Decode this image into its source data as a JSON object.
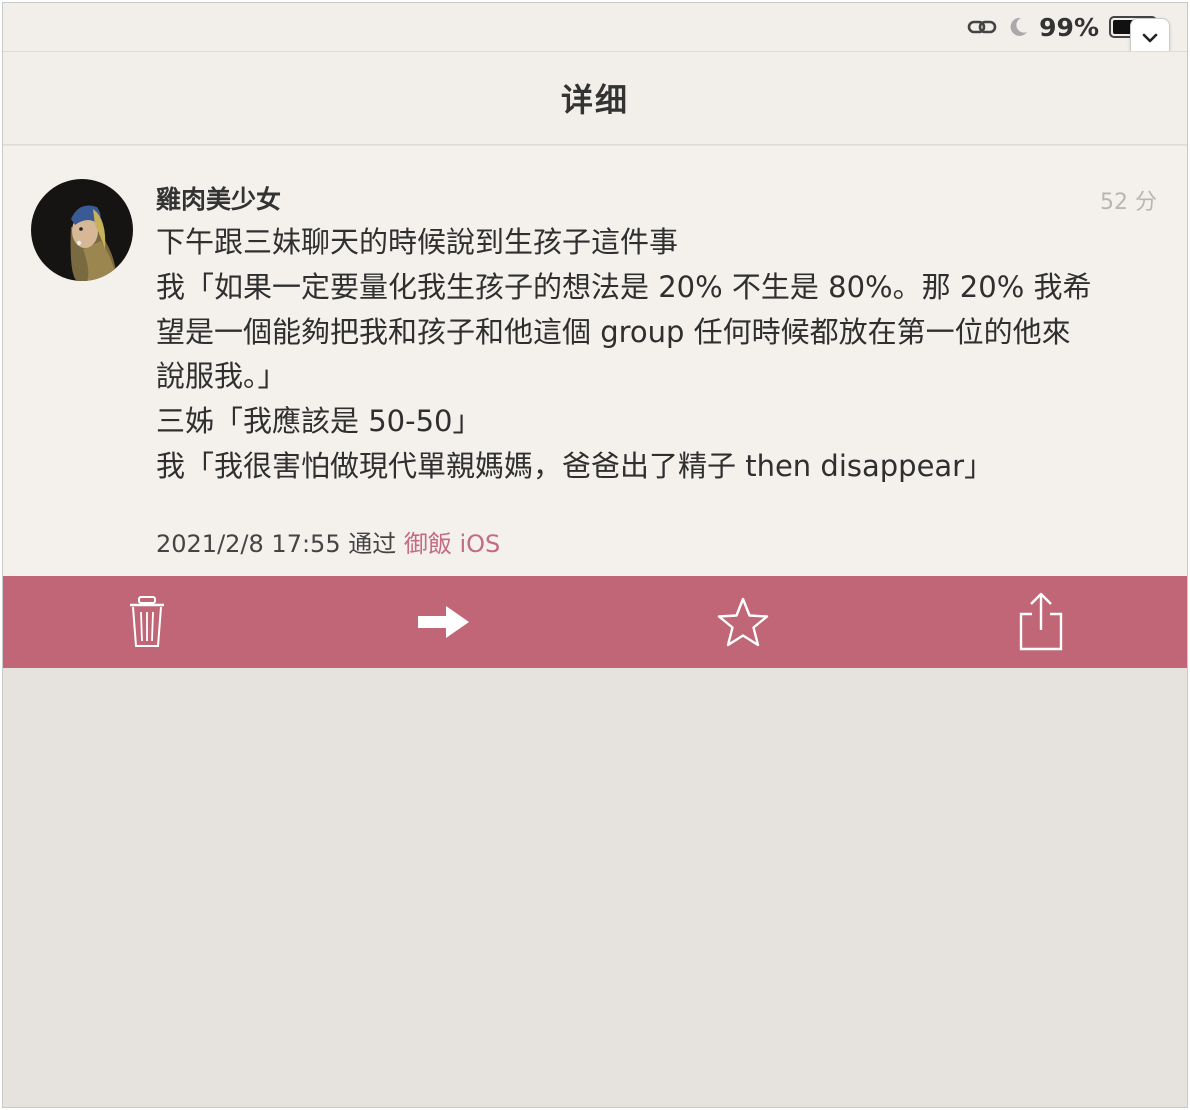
{
  "status_bar": {
    "battery_percent": "99%",
    "battery_level": 0.99,
    "icons": [
      "link-icon",
      "moon-icon",
      "battery-icon"
    ]
  },
  "navbar": {
    "title": "详细"
  },
  "post": {
    "username": "雞肉美少女",
    "time_ago": "52 分",
    "lines": [
      "下午跟三妹聊天的時候說到生孩子這件事",
      "我「如果一定要量化我生孩子的想法是 20% 不生是 80%。那 20% 我希",
      "望是一個能夠把我和孩子和他這個 group 任何時候都放在第一位的他來",
      "說服我。」",
      "三姊「我應該是 50-50」",
      "我「我很害怕做現代單親媽媽，爸爸出了精子 then disappear」"
    ],
    "timestamp": "2021/2/8 17:55",
    "via_label": "通过",
    "source": "御飯 iOS"
  },
  "toolbar": {
    "actions": [
      {
        "name": "delete",
        "icon": "trash-icon"
      },
      {
        "name": "forward",
        "icon": "arrow-right-icon"
      },
      {
        "name": "favorite",
        "icon": "star-icon"
      },
      {
        "name": "share",
        "icon": "share-icon"
      }
    ]
  },
  "colors": {
    "toolbar": "#c06676",
    "source_link": "#c36b80",
    "background": "#e6e2dd",
    "content_background": "#f4f1ed",
    "header_background": "#f2efeb"
  }
}
